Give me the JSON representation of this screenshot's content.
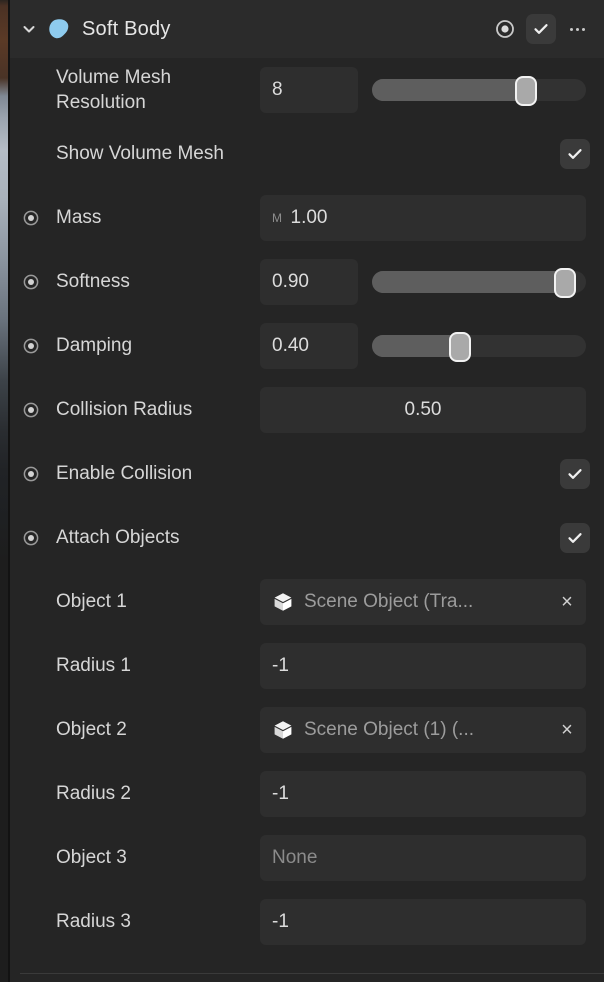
{
  "panel": {
    "header": {
      "title": "Soft Body",
      "expand_icon": "chevron-down-icon",
      "component_icon": "soft-body-blob-icon",
      "record_icon": "record-dot-icon",
      "enabled_checkmark": "✓",
      "overflow_label": "more-options"
    },
    "rows": [
      {
        "label": "Volume Mesh Resolution",
        "type": "number-slider",
        "value": "8",
        "slider_percent": 72,
        "has_indicator": false
      },
      {
        "label": "Show Volume Mesh",
        "type": "checkbox",
        "checked": true,
        "checkmark": "✓",
        "has_indicator": false
      },
      {
        "label": "Mass",
        "type": "number-unit",
        "unit": "M",
        "value": "1.00",
        "has_indicator": true
      },
      {
        "label": "Softness",
        "type": "number-slider",
        "value": "0.90",
        "slider_percent": 90,
        "has_indicator": true
      },
      {
        "label": "Damping",
        "type": "number-slider",
        "value": "0.40",
        "slider_percent": 41,
        "has_indicator": true
      },
      {
        "label": "Collision Radius",
        "type": "number-center",
        "value": "0.50",
        "has_indicator": true
      },
      {
        "label": "Enable Collision",
        "type": "checkbox",
        "checked": true,
        "checkmark": "✓",
        "has_indicator": true
      },
      {
        "label": "Attach Objects",
        "type": "checkbox",
        "checked": true,
        "checkmark": "✓",
        "has_indicator": true
      },
      {
        "label": "Object 1",
        "type": "object-ref",
        "value": "Scene Object (Tra...",
        "clear_label": "×",
        "object_icon": "cube-icon",
        "has_indicator": false
      },
      {
        "label": "Radius 1",
        "type": "number",
        "value": "-1",
        "has_indicator": false
      },
      {
        "label": "Object 2",
        "type": "object-ref",
        "value": "Scene Object (1) (...",
        "clear_label": "×",
        "object_icon": "cube-icon",
        "has_indicator": false
      },
      {
        "label": "Radius 2",
        "type": "number",
        "value": "-1",
        "has_indicator": false
      },
      {
        "label": "Object 3",
        "type": "object-ref",
        "value": "None",
        "empty": true,
        "object_icon": "none",
        "has_indicator": false
      },
      {
        "label": "Radius 3",
        "type": "number",
        "value": "-1",
        "has_indicator": false
      }
    ]
  },
  "colors": {
    "panel_bg": "#252525",
    "header_bg": "#2b2b2b",
    "field_bg": "#2e2e2e",
    "accent_blob": "#8ecbee",
    "text_primary": "#e6e6e6",
    "text_secondary": "#9c9c9c",
    "slider_fill": "#5e5e5e",
    "slider_track": "#323232"
  }
}
